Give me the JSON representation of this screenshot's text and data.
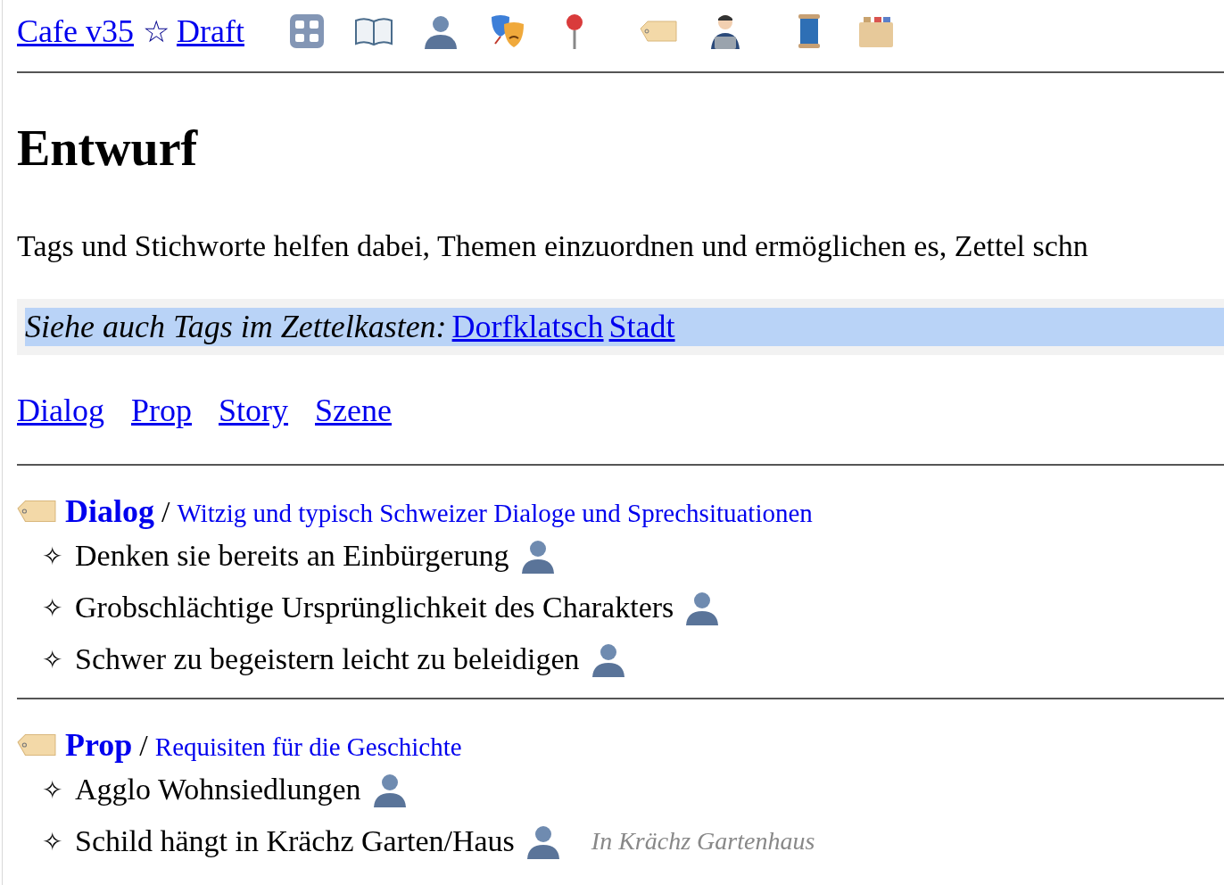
{
  "header": {
    "home_link": "Cafe v35",
    "star": "☆",
    "draft_link": "Draft"
  },
  "title": "Entwurf",
  "intro": "Tags und Stichworte helfen dabei, Themen einzuordnen und ermöglichen es, Zettel schn",
  "see_also": {
    "label": "Siehe auch Tags im Zettelkasten:",
    "links": [
      "Dorfklatsch",
      "Stadt"
    ]
  },
  "tag_links": [
    "Dialog",
    "Prop",
    "Story",
    "Szene"
  ],
  "sections": [
    {
      "name": "Dialog",
      "separator": "/",
      "description": "Witzig und typisch Schweizer Dialoge und Sprechsituationen",
      "items": [
        {
          "bullet": "✧",
          "text": "Denken sie bereits an Einbürgerung"
        },
        {
          "bullet": "✧",
          "text": "Grobschlächtige Ursprünglichkeit des Charakters"
        },
        {
          "bullet": "✧",
          "text": "Schwer zu begeistern leicht zu beleidigen"
        }
      ]
    },
    {
      "name": "Prop",
      "separator": "/",
      "description": "Requisiten für die Geschichte",
      "items": [
        {
          "bullet": "✧",
          "text": "Agglo Wohnsiedlungen"
        },
        {
          "bullet": "✧",
          "text": "Schild hängt in Krächz Garten/Haus",
          "note": "In Krächz Gartenhaus"
        }
      ]
    }
  ]
}
